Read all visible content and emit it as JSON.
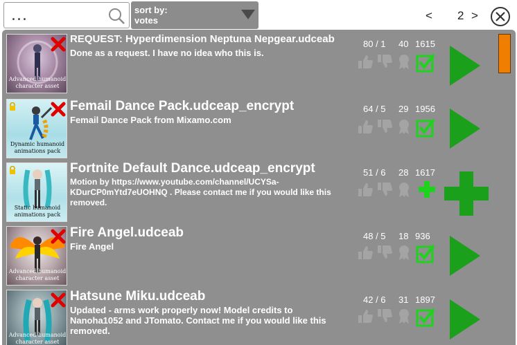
{
  "search": {
    "value": "..."
  },
  "sort": {
    "label": "sort by:",
    "value": "votes"
  },
  "pagination": {
    "prev": "<",
    "page": "2",
    "next": ">"
  },
  "colors": {
    "panel": "#8f8f8f",
    "accent_green": "#1aa01a",
    "check_green": "#1ed21e",
    "scrollbar": "#f07e00",
    "delete_red": "#e00000"
  },
  "items": [
    {
      "title": "REQUEST: Hyperdimension Neptuna Nepgear.udceab",
      "description": "Done as a request. I have no idea who this is.",
      "thumb_caption": "Advanced humanoid character asset",
      "votes": "80 / 1",
      "downloads": "40",
      "count": "1615",
      "action_icon": "play-arrow-icon",
      "locked": false
    },
    {
      "title": "Femail Dance Pack.udceap_encrypt",
      "description": "Femail Dance Pack from Mixamo.com",
      "thumb_caption": "Dynamic humanoid animations pack",
      "votes": "64 / 5",
      "downloads": "29",
      "count": "1956",
      "action_icon": "play-arrow-icon",
      "locked": true
    },
    {
      "title": "Fortnite Default Dance.udceap_encrypt",
      "description": "Motion by https://www.youtube.com/channel/UCYSa-KDurCP0mYtd7eUOHNQ . Please contact me if you would like this removed.",
      "thumb_caption": "Static humanoid animations pack",
      "votes": "51 / 6",
      "downloads": "28",
      "count": "1617",
      "action_icon": "plus-icon",
      "locked": true
    },
    {
      "title": "Fire Angel.udceab",
      "description": "Fire Angel",
      "thumb_caption": "Advanced humanoid character asset",
      "votes": "48 / 5",
      "downloads": "18",
      "count": "936",
      "action_icon": "play-arrow-icon",
      "locked": false
    },
    {
      "title": "Hatsune Miku.udceab",
      "description": "Updated - arms work properly now! Model credits to Nanoha1052 and JTomato. Contact me if you would like this removed.",
      "thumb_caption": "Advanced humanoid character asset",
      "votes": "42 / 6",
      "downloads": "31",
      "count": "1897",
      "action_icon": "play-arrow-icon",
      "locked": false
    }
  ]
}
